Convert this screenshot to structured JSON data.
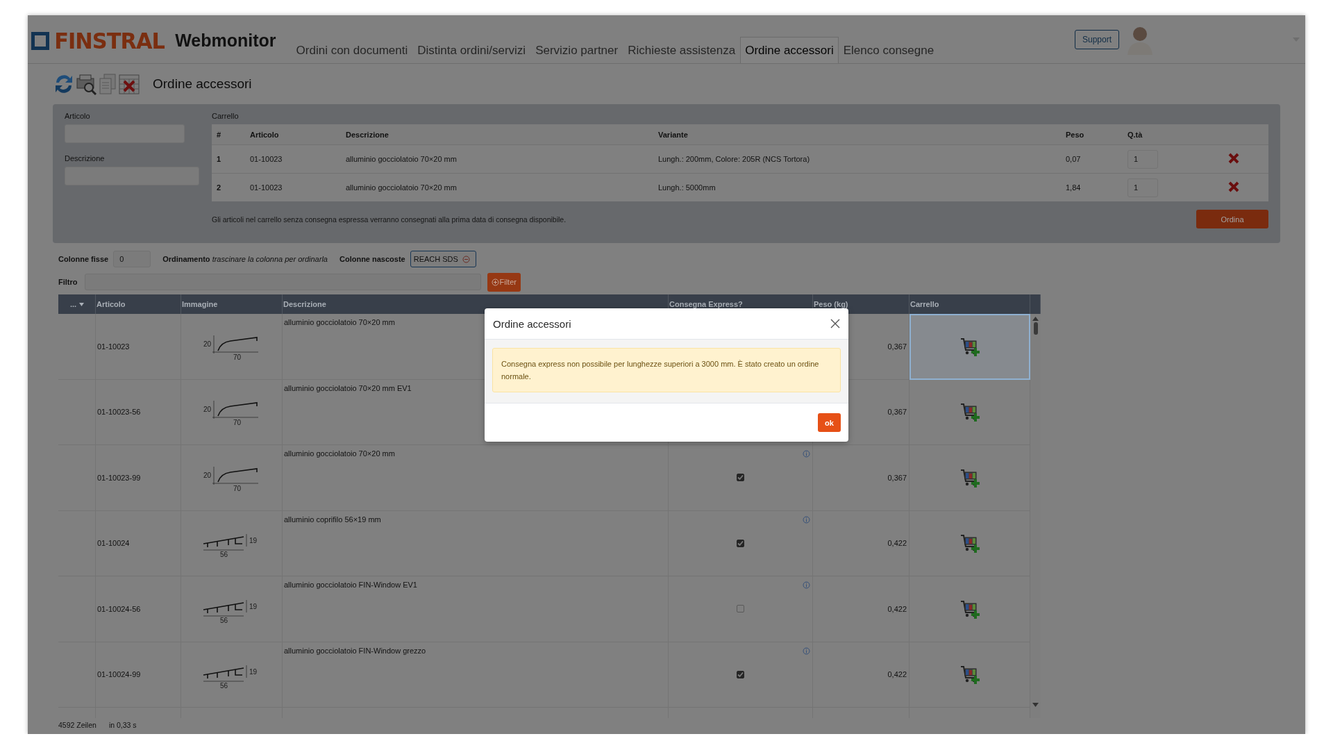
{
  "header": {
    "logo": "FINSTRAL",
    "app_name": "Webmonitor",
    "tabs": [
      {
        "label": "Ordini con documenti",
        "selected": false
      },
      {
        "label": "Distinta ordini/servizi",
        "selected": false
      },
      {
        "label": "Servizio partner",
        "selected": false
      },
      {
        "label": "Richieste assistenza",
        "selected": false
      },
      {
        "label": "Ordine accessori",
        "selected": true
      },
      {
        "label": "Elenco consegne",
        "selected": false
      }
    ],
    "support_button": "Support"
  },
  "page": {
    "title": "Ordine accessori"
  },
  "search": {
    "article_label": "Articolo",
    "description_label": "Descrizione"
  },
  "cart": {
    "title": "Carrello",
    "columns": [
      "#",
      "Articolo",
      "Descrizione",
      "Variante",
      "Peso",
      "Q.tà"
    ],
    "rows": [
      {
        "index": "1",
        "article": "01-10023",
        "description": "alluminio gocciolatoio 70×20 mm",
        "variant": "Lungh.: 200mm, Colore: 205R (NCS Tortora)",
        "weight": "0,07",
        "quantity": "1"
      },
      {
        "index": "2",
        "article": "01-10023",
        "description": "alluminio gocciolatoio 70×20 mm",
        "variant": "Lungh.: 5000mm",
        "weight": "1,84",
        "quantity": "1"
      }
    ],
    "note": "Gli articoli nel carrello senza consegna espressa verranno consegnati alla prima data di consegna disponibile.",
    "order_button": "Ordina"
  },
  "options": {
    "fixed_columns_label": "Colonne fisse",
    "fixed_columns": "0",
    "sort_label": "Ordinamento",
    "sort_hint": "trascinare la colonna per ordinarla",
    "hidden_columns_label": "Colonne nascoste",
    "hidden_columns": [
      "REACH SDS"
    ],
    "filter_label": "Filtro",
    "filter_button": "Filter"
  },
  "table": {
    "columns": [
      "...",
      "Articolo",
      "Immagine",
      "Descrizione",
      "Consegna Express?",
      "Peso (kg)",
      "Carrello"
    ],
    "rows": [
      {
        "article": "01-10023",
        "image": {
          "kind": "drip",
          "dims": [
            "20",
            "70"
          ]
        },
        "description": "alluminio gocciolatoio 70×20 mm",
        "weight": "0,367",
        "selected": true
      },
      {
        "article": "01-10023-56",
        "image": {
          "kind": "drip",
          "dims": [
            "20",
            "70"
          ]
        },
        "description": "alluminio gocciolatoio 70×20 mm EV1",
        "weight": "0,367",
        "selected": false
      },
      {
        "article": "01-10023-99",
        "image": {
          "kind": "drip",
          "dims": [
            "20",
            "70"
          ]
        },
        "description": "alluminio gocciolatoio 70×20 mm",
        "express": true,
        "weight": "0,367",
        "selected": false
      },
      {
        "article": "01-10024",
        "image": {
          "kind": "cover",
          "dims": [
            "19",
            "56"
          ]
        },
        "description": "alluminio coprifilo 56×19 mm",
        "express": true,
        "weight": "0,422",
        "selected": false
      },
      {
        "article": "01-10024-56",
        "image": {
          "kind": "cover",
          "dims": [
            "19",
            "56"
          ]
        },
        "description": "alluminio gocciolatoio FIN-Window EV1",
        "express": false,
        "weight": "0,422",
        "selected": false
      },
      {
        "article": "01-10024-99",
        "image": {
          "kind": "cover",
          "dims": [
            "19",
            "56"
          ]
        },
        "description": "alluminio gocciolatoio FIN-Window grezzo",
        "express": true,
        "weight": "0,422",
        "selected": false
      }
    ],
    "row_count": "4592 Zeilen",
    "time": "in 0,33 s"
  },
  "dialog": {
    "title": "Ordine accessori",
    "message": "Consegna express non possibile per lunghezze superiori a 3000 mm. È stato creato un ordine normale.",
    "ok_button": "ok"
  }
}
